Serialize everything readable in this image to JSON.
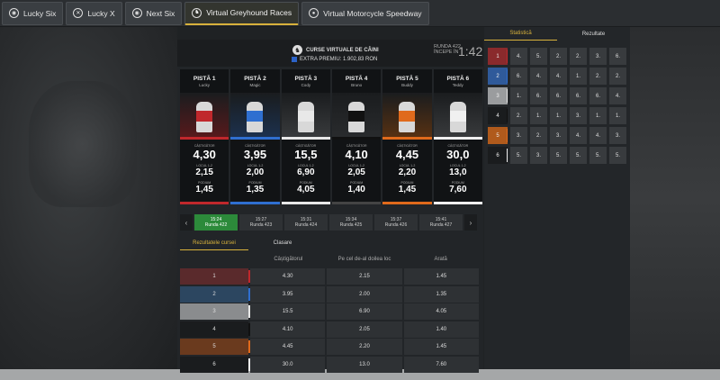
{
  "tabs": [
    {
      "label": "Lucky Six",
      "icon": "circle-icon"
    },
    {
      "label": "Lucky X",
      "icon": "x-circle-icon"
    },
    {
      "label": "Next Six",
      "icon": "circle-icon"
    },
    {
      "label": "Virtual Greyhound Races",
      "icon": "greyhound-icon",
      "active": true
    },
    {
      "label": "Virtual Motorcycle Speedway",
      "icon": "helmet-icon"
    }
  ],
  "header": {
    "title": "CURSE VIRTUALE DE CÂINI",
    "prize_label": "EXTRA PREMIU: 1.902,83 RON",
    "round_label": "RUNDA 422",
    "round_sub": "ÎNCEPE ÎN",
    "timer": "1:42"
  },
  "colors": {
    "accent": "#d8b23c",
    "track1": "#c0282c",
    "track2": "#2f6fd0",
    "track3": "#e8e8e8",
    "track4": "#111111",
    "track5": "#e06a1c",
    "track6": "#f0f0f0",
    "race_active": "#2c8a3a"
  },
  "odds_labels": {
    "win": "CÂȘTIGĂTOR",
    "place": "LOCUL 1-2",
    "podium": "PODIUM"
  },
  "tracks": [
    {
      "name": "PISTĂ 1",
      "dog": "Lucky",
      "win": "4,30",
      "place": "2,15",
      "podium": "1,45"
    },
    {
      "name": "PISTĂ 2",
      "dog": "Magic",
      "win": "3,95",
      "place": "2,00",
      "podium": "1,35"
    },
    {
      "name": "PISTĂ 3",
      "dog": "Cody",
      "win": "15,5",
      "place": "6,90",
      "podium": "4,05"
    },
    {
      "name": "PISTĂ 4",
      "dog": "Bruno",
      "win": "4,10",
      "place": "2,05",
      "podium": "1,40"
    },
    {
      "name": "PISTĂ 5",
      "dog": "Buddy",
      "win": "4,45",
      "place": "2,20",
      "podium": "1,45"
    },
    {
      "name": "PISTĂ 6",
      "dog": "Teddy",
      "win": "30,0",
      "place": "13,0",
      "podium": "7,60"
    }
  ],
  "races": [
    {
      "time": "15:24",
      "round": "Runda 422",
      "active": true
    },
    {
      "time": "15:27",
      "round": "Runda 423"
    },
    {
      "time": "15:31",
      "round": "Runda 424"
    },
    {
      "time": "15:34",
      "round": "Runda 425"
    },
    {
      "time": "15:37",
      "round": "Runda 426"
    },
    {
      "time": "15:41",
      "round": "Runda 427"
    }
  ],
  "results_tabs": [
    "Rezultatele cursei",
    "Clasare"
  ],
  "results_header": [
    "",
    "Câștigătorul",
    "Pe cel de-al doilea loc",
    "Arată"
  ],
  "results_rows": [
    {
      "num": "1",
      "win": "4.30",
      "second": "2.15",
      "show": "1.45"
    },
    {
      "num": "2",
      "win": "3.95",
      "second": "2.00",
      "show": "1.35"
    },
    {
      "num": "3",
      "win": "15.5",
      "second": "6.90",
      "show": "4.05"
    },
    {
      "num": "4",
      "win": "4.10",
      "second": "2.05",
      "show": "1.40"
    },
    {
      "num": "5",
      "win": "4.45",
      "second": "2.20",
      "show": "1.45"
    },
    {
      "num": "6",
      "win": "30.0",
      "second": "13.0",
      "show": "7.60"
    }
  ],
  "stats_tabs": [
    "Statistică",
    "Rezultate"
  ],
  "stats_rows": [
    {
      "num": "1",
      "values": [
        "4.",
        "5.",
        "2.",
        "2.",
        "3.",
        "6."
      ]
    },
    {
      "num": "2",
      "values": [
        "6.",
        "4.",
        "4.",
        "1.",
        "2.",
        "2."
      ]
    },
    {
      "num": "3",
      "values": [
        "1.",
        "6.",
        "6.",
        "6.",
        "6.",
        "4."
      ]
    },
    {
      "num": "4",
      "values": [
        "2.",
        "1.",
        "1.",
        "3.",
        "1.",
        "1."
      ]
    },
    {
      "num": "5",
      "values": [
        "3.",
        "2.",
        "3.",
        "4.",
        "4.",
        "3."
      ]
    },
    {
      "num": "6",
      "values": [
        "5.",
        "3.",
        "5.",
        "5.",
        "5.",
        "5."
      ]
    }
  ]
}
